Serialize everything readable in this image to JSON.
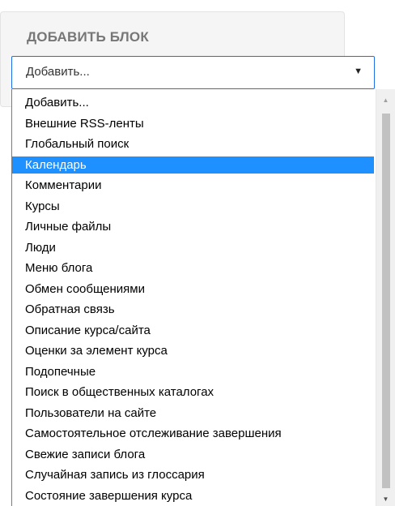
{
  "block": {
    "title": "ДОБАВИТЬ БЛОК"
  },
  "select": {
    "value": "Добавить...",
    "caret": "▼"
  },
  "options": [
    "Добавить...",
    "Внешние RSS-ленты",
    "Глобальный поиск",
    "Календарь",
    "Комментарии",
    "Курсы",
    "Личные файлы",
    "Люди",
    "Меню блога",
    "Обмен сообщениями",
    "Обратная связь",
    "Описание курса/сайта",
    "Оценки за элемент курса",
    "Подопечные",
    "Поиск в общественных каталогах",
    "Пользователи на сайте",
    "Самостоятельное отслеживание завершения",
    "Свежие записи блога",
    "Случайная запись из глоссария",
    "Состояние завершения курса"
  ],
  "highlighted_option": "Календарь",
  "scrollbar": {
    "up_arrow": "▲",
    "down_arrow": "▼"
  },
  "colors": {
    "highlight": "#1e90ff",
    "select_border": "#1e6fe8",
    "title": "#777777"
  }
}
